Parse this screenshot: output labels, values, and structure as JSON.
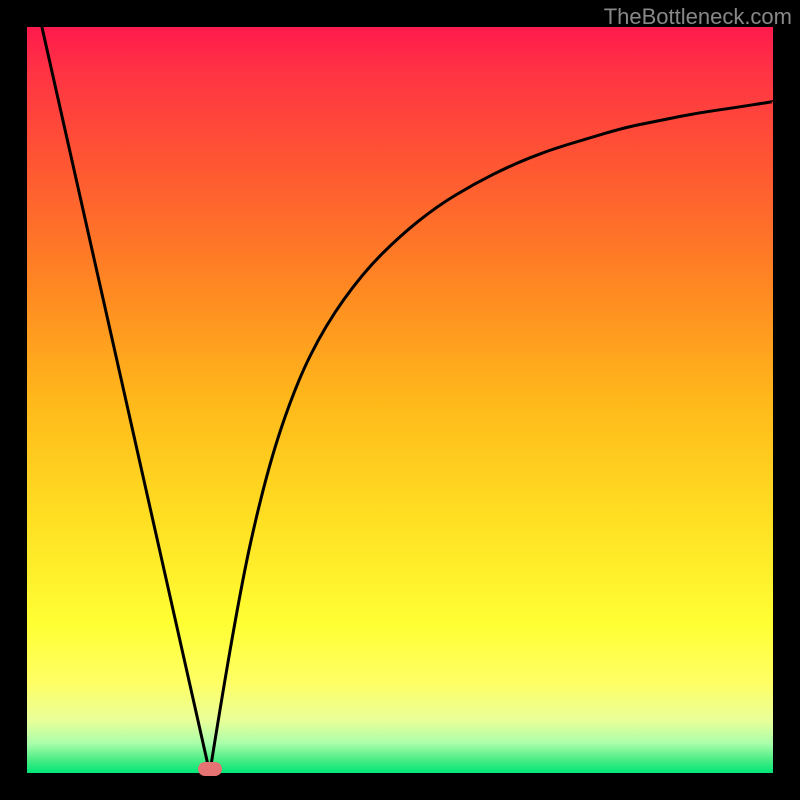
{
  "watermark": "TheBottleneck.com",
  "chart_data": {
    "type": "line",
    "title": "",
    "xlabel": "",
    "ylabel": "",
    "xlim": [
      0,
      100
    ],
    "ylim": [
      0,
      100
    ],
    "series": [
      {
        "name": "left-branch",
        "x": [
          2,
          24.5
        ],
        "y": [
          100,
          0
        ]
      },
      {
        "name": "right-branch",
        "x": [
          24.5,
          28,
          32,
          36,
          40,
          45,
          50,
          55,
          60,
          65,
          70,
          75,
          80,
          85,
          90,
          95,
          100
        ],
        "y": [
          0,
          22,
          40,
          52,
          60,
          67,
          72,
          76,
          79,
          81.5,
          83.5,
          85,
          86.5,
          87.5,
          88.5,
          89.2,
          90
        ]
      }
    ],
    "marker": {
      "x": 24.5,
      "y": 0.5,
      "color": "#e57373"
    },
    "gradient_stops": [
      {
        "pos": 0,
        "color": "#ff1a4d"
      },
      {
        "pos": 0.5,
        "color": "#ffdd22"
      },
      {
        "pos": 1,
        "color": "#00e676"
      }
    ]
  }
}
